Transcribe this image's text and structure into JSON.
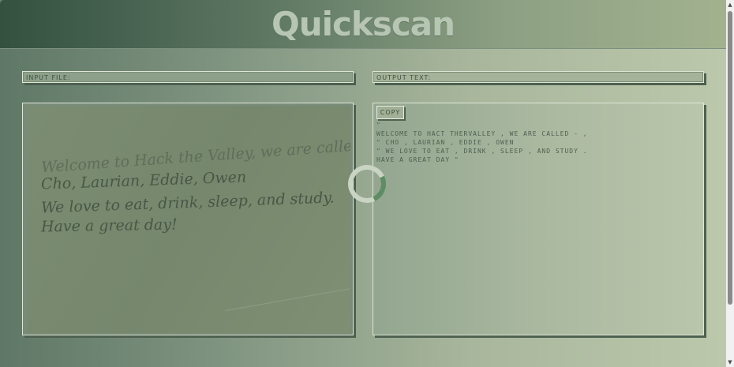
{
  "header": {
    "logo_text": "Quickscan"
  },
  "input_file": {
    "label": "INPUT FILE:"
  },
  "output_text": {
    "label": "OUTPUT TEXT:"
  },
  "scan_image": {
    "lines": [
      "Welcome to Hack the Valley, we are called:",
      "Cho, Laurian, Eddie, Owen",
      "We love to eat, drink, sleep, and study.",
      "Have a great day!"
    ]
  },
  "output_panel": {
    "copy_label": "COPY",
    "text": "\"\nWELCOME TO HACT THERVALLEY , WE ARE CALLED - ,\n\" CHO , LAURIAN , EDDIE , OWEN\n\" WE LOVE TO EAT , DRINK , SLEEP , AND STUDY .\nHAVE A GREAT DAY \""
  },
  "spinner": {
    "icon": "loading-spinner-icon",
    "color": "#5e8c64"
  },
  "scrollbar": {
    "up_glyph": "▲",
    "down_glyph": "▼"
  },
  "colors": {
    "header_dark": "#34503f",
    "header_light": "#a2b28f",
    "logo": "#b6c6b2",
    "panel_shadow": "#4e6150"
  }
}
